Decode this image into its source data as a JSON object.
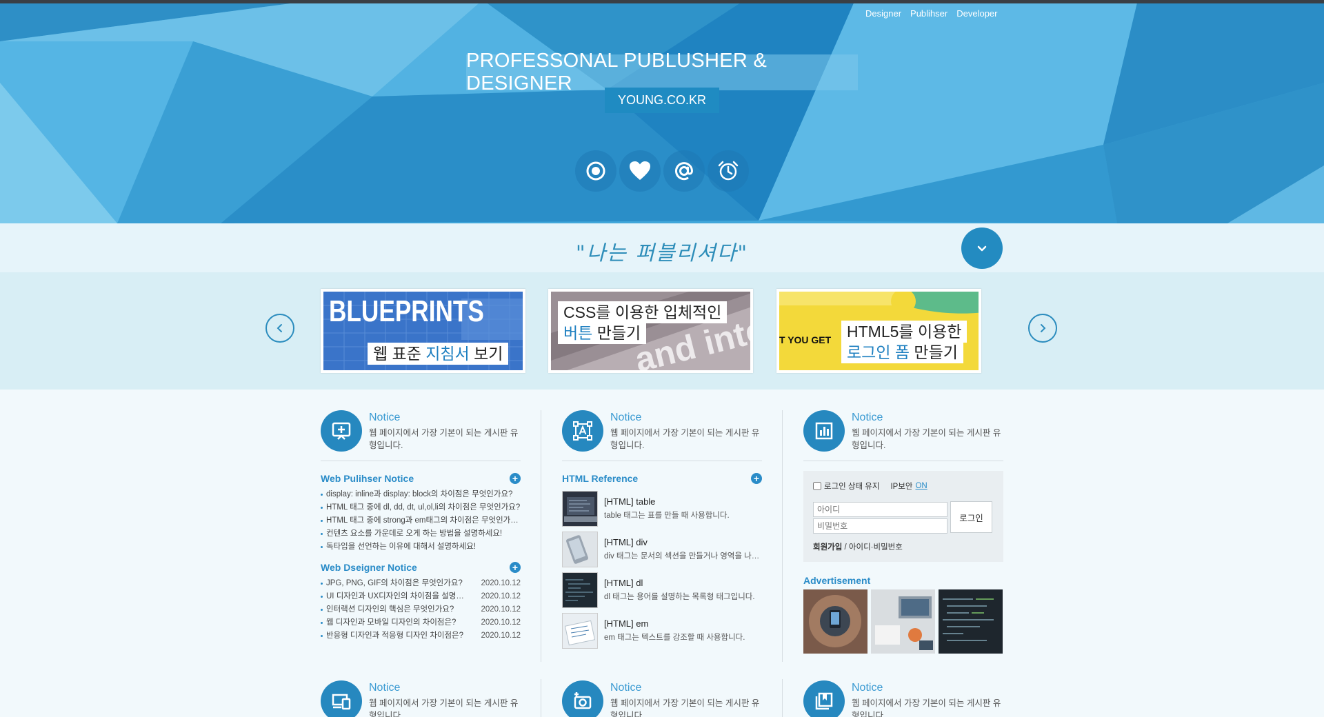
{
  "header": {
    "top_menu": [
      "Designer",
      "Publihser",
      "Developer"
    ],
    "title": "PROFESSONAL PUBLUSHER & DESIGNER",
    "subtitle": "YOUNG.CO.KR",
    "icons": [
      "record-icon",
      "heart-icon",
      "at-icon",
      "alarm-clock-icon"
    ]
  },
  "slogan": {
    "text": "\"나는 퍼블리셔다\"",
    "down_icon": "chevron-down-icon"
  },
  "slider": {
    "slides": [
      {
        "title": "BLUEPRINTS",
        "caption_pre": "웹 표준 ",
        "caption_hl": "지침서",
        "caption_post": " 보기"
      },
      {
        "line1": "CSS를 이용한 입체적인",
        "line2_hl": "버튼",
        "line2_post": " 만들기",
        "bg_text": "and inte"
      },
      {
        "side_text": "T YOU GET",
        "line1": "HTML5를 이용한",
        "line2_hl": "로그인 폼",
        "line2_post": " 만들기"
      }
    ]
  },
  "columns": {
    "notice": {
      "title": "Notice",
      "desc": "웹 페이지에서 가장 기본이 되는 게시판 유형입니다."
    },
    "publisher": {
      "title": "Web Pulihser Notice",
      "items": [
        "display: inline과 display: block의 차이점은 무엇인가요?",
        "HTML 태그 중에 dl, dd, dt, ul,ol,li의 차이점은 무엇인가요?",
        "HTML 태그 중에 strong과 em태그의 차이점은 무엇인가요?",
        "컨텐츠 요소를 가운데로 오게 하는 방법을 설명하세요!",
        "독타입을 선언하는 이유에 대해서 설명하세요!"
      ]
    },
    "designer": {
      "title": "Web Dseigner Notice",
      "items": [
        {
          "t": "JPG, PNG, GIF의 차이점은 무엇인가요?",
          "d": "2020.10.12"
        },
        {
          "t": "UI 디자인과 UX디자인의 차이점을 설명하세요",
          "d": "2020.10.12"
        },
        {
          "t": "인터랙션 디자인의 핵심은 무엇인가요?",
          "d": "2020.10.12"
        },
        {
          "t": "웹 디자인과 모바일 디자인의 차이점은?",
          "d": "2020.10.12"
        },
        {
          "t": "반응형 디자인과 적응형 디자인 차이점은?",
          "d": "2020.10.12"
        }
      ]
    },
    "reference": {
      "title": "HTML Reference",
      "items": [
        {
          "title": "[HTML] table",
          "desc": "table 태그는 표를 만들 때 사용합니다."
        },
        {
          "title": "[HTML] div",
          "desc": "div 태그는 문서의 섹션을 만들거나 영역을 나눌 때 사용합니다."
        },
        {
          "title": "[HTML] dl",
          "desc": "dl 태그는 용어를 설명하는 목록형 태그입니다."
        },
        {
          "title": "[HTML] em",
          "desc": "em 태그는 텍스트를 강조할 때 사용합니다."
        }
      ]
    },
    "login": {
      "keep": "로그인 상태 유지",
      "ip_label": "IP보안",
      "ip_value": "ON",
      "id_placeholder": "아이디",
      "pw_placeholder": "비밀번호",
      "button": "로그인",
      "join": "회원가입",
      "separator": " / ",
      "find": "아이디·비밀번호"
    },
    "ad": {
      "title": "Advertisement"
    }
  },
  "colors": {
    "header_blue": "#3fa6d9",
    "accent": "#2688bf",
    "link": "#2a8cc8"
  }
}
